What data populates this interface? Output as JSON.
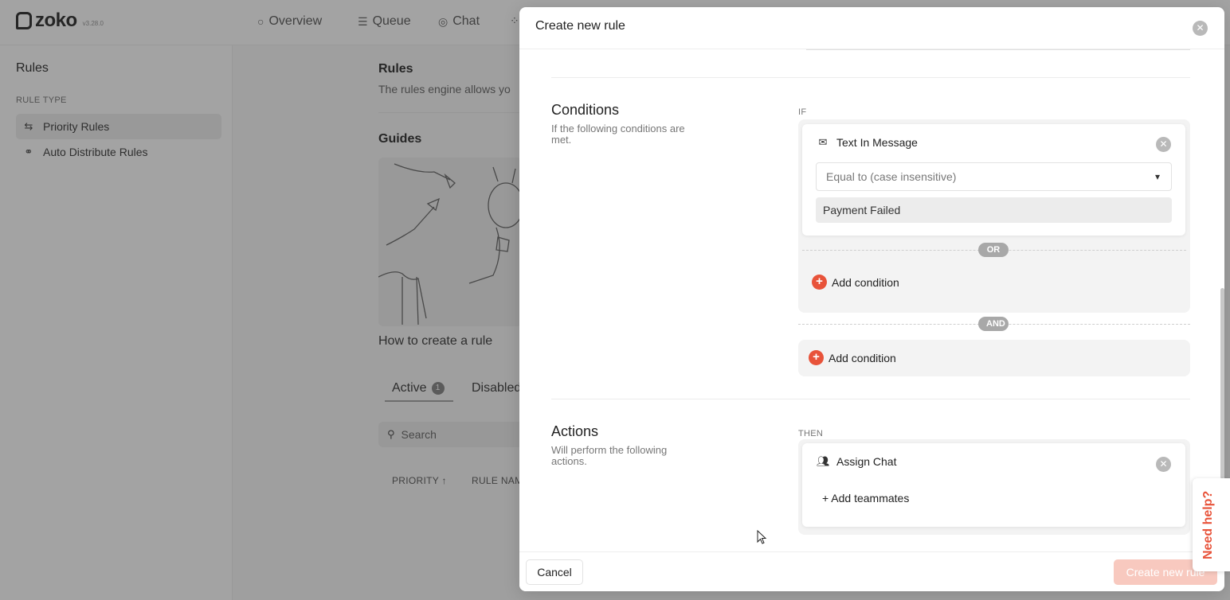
{
  "app": {
    "logo": "zoko",
    "version": "v3.28.0",
    "nav": [
      {
        "label": "Overview",
        "icon": "circle-icon"
      },
      {
        "label": "Queue",
        "icon": "queue-icon"
      },
      {
        "label": "Chat",
        "icon": "chat-icon"
      }
    ]
  },
  "sidebar": {
    "title": "Rules",
    "section_label": "RULE TYPE",
    "items": [
      {
        "label": "Priority Rules",
        "icon": "priority-rules-icon",
        "active": true
      },
      {
        "label": "Auto Distribute Rules",
        "icon": "distribute-icon",
        "active": false
      }
    ]
  },
  "main": {
    "title": "Rules",
    "subtitle": "The rules engine allows yo",
    "guides_title": "Guides",
    "guide_caption": "How to create a rule",
    "tabs": [
      {
        "label": "Active",
        "count": "1"
      },
      {
        "label": "Disabled"
      }
    ],
    "search_placeholder": "Search",
    "columns": [
      "PRIORITY ↑",
      "RULE NAM"
    ]
  },
  "modal": {
    "title": "Create new rule",
    "conditions": {
      "title": "Conditions",
      "description": "If the following conditions are met.",
      "label": "IF",
      "condition": {
        "title": "Text In Message",
        "operator": "Equal to (case insensitive)",
        "value": "Payment Failed"
      },
      "or_label": "OR",
      "and_label": "AND",
      "add_condition_label": "Add condition"
    },
    "actions": {
      "title": "Actions",
      "description": "Will perform the following actions.",
      "label": "THEN",
      "action": {
        "title": "Assign Chat",
        "add_label": "+ Add teammates"
      }
    },
    "footer": {
      "cancel_label": "Cancel",
      "create_label": "Create new rule"
    }
  },
  "help_tab": {
    "label": "Need help?"
  },
  "colors": {
    "accent": "#e8533a",
    "accent_disabled": "#f8c9bf",
    "overlay": "rgba(60,60,60,0.47)"
  }
}
